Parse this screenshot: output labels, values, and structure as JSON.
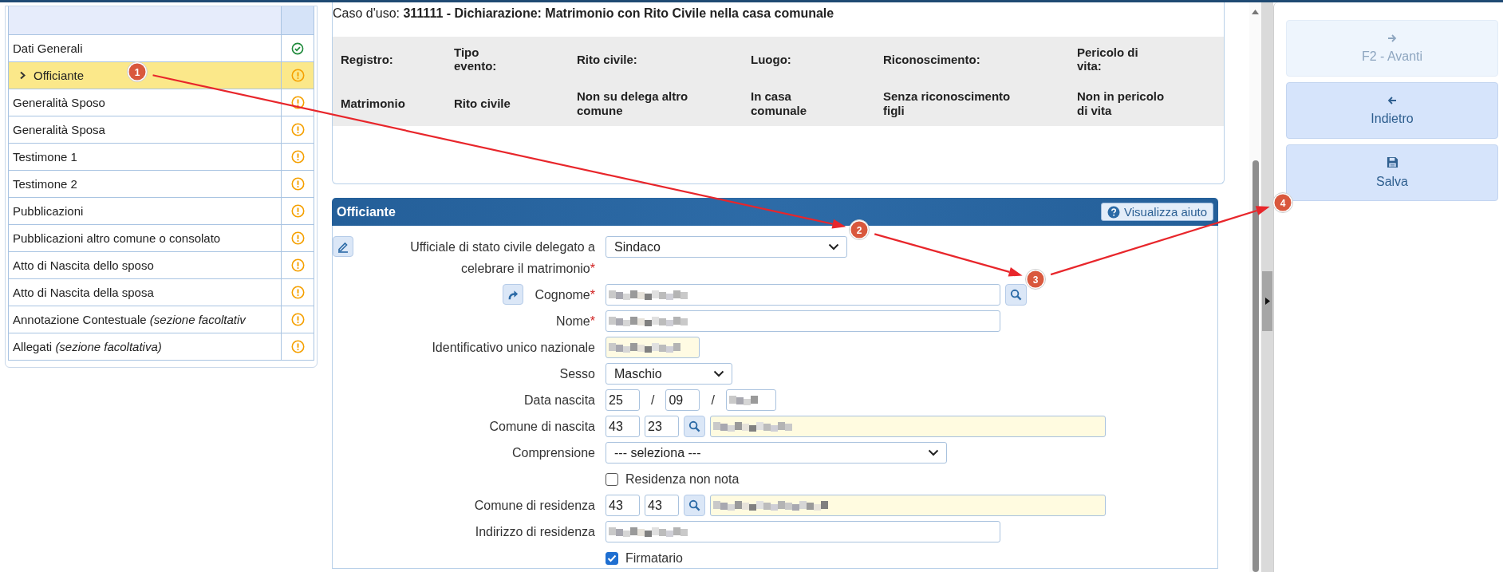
{
  "sidebar": {
    "items": [
      {
        "label": "Dati Generali",
        "kind": "complete",
        "selected": false
      },
      {
        "label": "Officiante",
        "kind": "warning",
        "selected": true
      },
      {
        "label": "Generalità Sposo",
        "kind": "warning",
        "selected": false
      },
      {
        "label": "Generalità Sposa",
        "kind": "warning",
        "selected": false
      },
      {
        "label": "Testimone 1",
        "kind": "warning",
        "selected": false
      },
      {
        "label": "Testimone 2",
        "kind": "warning",
        "selected": false
      },
      {
        "label": "Pubblicazioni",
        "kind": "warning",
        "selected": false
      },
      {
        "label": "Pubblicazioni altro comune o consolato",
        "kind": "warning",
        "selected": false
      },
      {
        "label": "Atto di Nascita dello sposo",
        "kind": "warning",
        "selected": false
      },
      {
        "label": "Atto di Nascita della sposa",
        "kind": "warning",
        "selected": false
      },
      {
        "label": "Annotazione Contestuale *(sezione facoltativ*",
        "kind": "warning",
        "selected": false
      },
      {
        "label": "Allegati *(sezione facoltativa)*",
        "kind": "warning",
        "selected": false
      }
    ]
  },
  "case": {
    "text": "Caso d'uso: **311111 - Dichiarazione: Matrimonio con Rito Civile nella casa comunale**"
  },
  "summary": {
    "columns": [
      {
        "header": "Registro:",
        "value": "Matrimonio"
      },
      {
        "header": "Tipo evento:",
        "value": "Rito civile"
      },
      {
        "header": "Rito civile:",
        "value": "Non su delega altro comune"
      },
      {
        "header": "Luogo:",
        "value": "In casa comunale"
      },
      {
        "header": "Riconoscimento:",
        "value": "Senza riconoscimento figli"
      },
      {
        "header": "Pericolo di vita:",
        "value": "Non in pericolo di vita"
      }
    ]
  },
  "section": {
    "title": "Officiante",
    "help_button": "Visualizza aiuto",
    "fields": [
      {
        "kind": "select",
        "label": "Ufficiale di stato civile delegato a celebrare il matrimonio",
        "required_mark": "*",
        "value": "Sindaco"
      },
      {
        "kind": "text",
        "label": "Cognome",
        "required_mark": "*",
        "search": true,
        "blurred": true
      },
      {
        "kind": "text",
        "label": "Nome",
        "required_mark": "*",
        "blurred": true
      },
      {
        "kind": "code",
        "label": "Identificativo unico nazionale",
        "blurred": true
      },
      {
        "kind": "select",
        "label": "Sesso",
        "value": "Maschio"
      },
      {
        "kind": "date",
        "label": "Data nascita",
        "day": "25",
        "month": "09",
        "separators": [
          "/",
          "/"
        ]
      },
      {
        "kind": "comune",
        "label": "Comune di nascita",
        "code1": "43",
        "code2": "23"
      },
      {
        "kind": "select",
        "label": "Comprensione",
        "value": "--- seleziona ---"
      },
      {
        "kind": "checkbox",
        "label": "Residenza non nota",
        "checked": false
      },
      {
        "kind": "comune",
        "label": "Comune di residenza",
        "code1": "43",
        "code2": "43"
      },
      {
        "kind": "text",
        "label": "Indirizzo di residenza",
        "blurred": true
      },
      {
        "kind": "checkbox",
        "label": "Firmatario",
        "checked": true
      }
    ]
  },
  "actions": [
    {
      "label": "F2 - Avanti",
      "disabled": true
    },
    {
      "label": "Indietro",
      "disabled": false
    },
    {
      "label": "Salva",
      "disabled": false
    }
  ],
  "annotations": [
    {
      "number": "1"
    },
    {
      "number": "2"
    },
    {
      "number": "3"
    },
    {
      "number": "4"
    }
  ]
}
